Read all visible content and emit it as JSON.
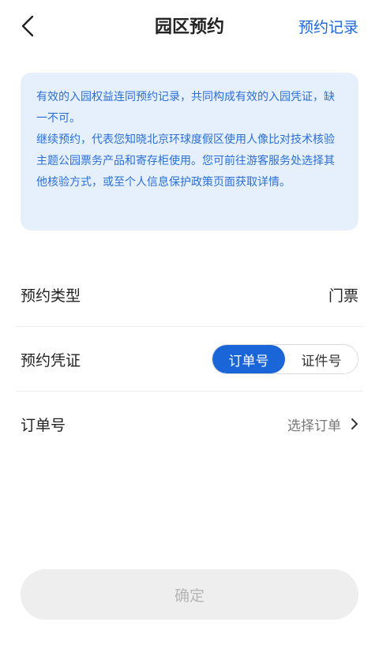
{
  "header": {
    "title": "园区预约",
    "link_label": "预约记录"
  },
  "notice": {
    "line1": "有效的入园权益连同预约记录，共同构成有效的入园凭证，缺一不可。",
    "line2": "继续预约，代表您知晓北京环球度假区使用人像比对技术核验主题公园票务产品和寄存柜使用。您可前往游客服务处选择其他核验方式，或至个人信息保护政策页面获取详情。"
  },
  "form": {
    "type_label": "预约类型",
    "type_value": "门票",
    "credential_label": "预约凭证",
    "credential_options": [
      "订单号",
      "证件号"
    ],
    "order_label": "订单号",
    "order_placeholder": "选择订单"
  },
  "footer": {
    "confirm_label": "确定"
  },
  "colors": {
    "accent": "#1a66d9",
    "notice_bg": "#e6f0fd",
    "disabled_bg": "#eeeeee"
  }
}
